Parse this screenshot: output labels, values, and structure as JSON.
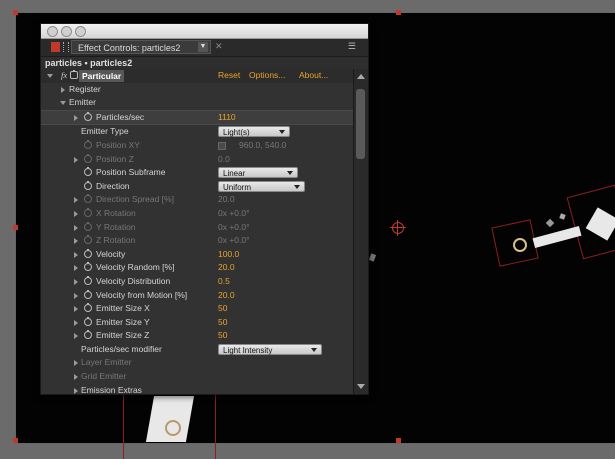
{
  "panel": {
    "tab_title": "Effect Controls: particles2",
    "breadcrumb": "particles • particles2",
    "menu_icon": "panel-menu-icon"
  },
  "effect": {
    "fx_label": "fx",
    "name": "Particular",
    "reset": "Reset",
    "options": "Options...",
    "about": "About..."
  },
  "rows": {
    "register": "Register",
    "emitter": "Emitter",
    "particles_sec": {
      "label": "Particles/sec",
      "value": "1110"
    },
    "emitter_type": {
      "label": "Emitter Type",
      "value": "Light(s)"
    },
    "position_xy": {
      "label": "Position XY",
      "value": "960.0, 540.0"
    },
    "position_z": {
      "label": "Position Z",
      "value": "0.0"
    },
    "position_subframe": {
      "label": "Position Subframe",
      "value": "Linear"
    },
    "direction": {
      "label": "Direction",
      "value": "Uniform"
    },
    "direction_spread": {
      "label": "Direction Spread [%]",
      "value": "20.0"
    },
    "x_rotation": {
      "label": "X Rotation",
      "value": "0x +0.0°"
    },
    "y_rotation": {
      "label": "Y Rotation",
      "value": "0x +0.0°"
    },
    "z_rotation": {
      "label": "Z Rotation",
      "value": "0x +0.0°"
    },
    "velocity": {
      "label": "Velocity",
      "value": "100.0"
    },
    "velocity_random": {
      "label": "Velocity Random [%]",
      "value": "20.0"
    },
    "velocity_distribution": {
      "label": "Velocity Distribution",
      "value": "0.5"
    },
    "velocity_from_motion": {
      "label": "Velocity from Motion [%]",
      "value": "20.0"
    },
    "emitter_size_x": {
      "label": "Emitter Size X",
      "value": "50"
    },
    "emitter_size_y": {
      "label": "Emitter Size Y",
      "value": "50"
    },
    "emitter_size_z": {
      "label": "Emitter Size Z",
      "value": "50"
    },
    "particles_sec_modifier": {
      "label": "Particles/sec modifier",
      "value": "Light Intensity"
    },
    "layer_emitter": "Layer Emitter",
    "grid_emitter": "Grid Emitter",
    "emission_extras": "Emission Extras"
  },
  "colors": {
    "value_accent": "#e9a42a",
    "panel_bg": "#323232",
    "handle_red": "#c0392b"
  }
}
